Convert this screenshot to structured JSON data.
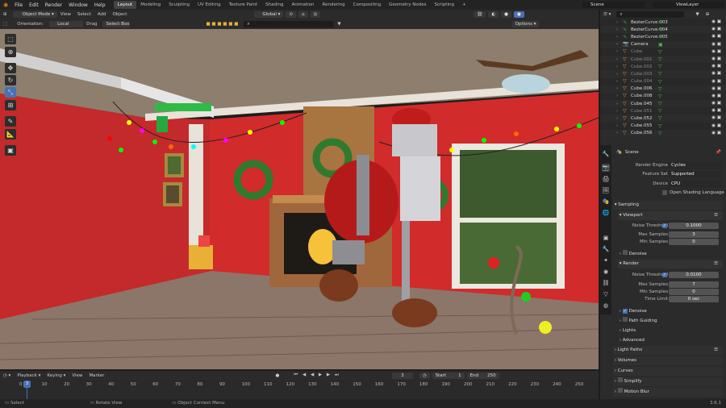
{
  "menus": [
    "File",
    "Edit",
    "Render",
    "Window",
    "Help"
  ],
  "workspaces": [
    "Layout",
    "Modeling",
    "Sculpting",
    "UV Editing",
    "Texture Paint",
    "Shading",
    "Animation",
    "Rendering",
    "Compositing",
    "Geometry Nodes",
    "Scripting"
  ],
  "add_workspace": "+",
  "scene": "Scene",
  "view_layer": "ViewLayer",
  "viewport_header": {
    "mode": "Object Mode",
    "view": "View",
    "select": "Select",
    "add": "Add",
    "object": "Object",
    "transform": "Global",
    "orientation_label": "Orientation:",
    "orientation_value": "Local",
    "drag_label": "Drag",
    "drag_value": "Select Box",
    "options": "Options"
  },
  "outliner": {
    "items": [
      {
        "name": "BezierCurve.003",
        "icon": "curve-icon",
        "dim": false
      },
      {
        "name": "BezierCurve.004",
        "icon": "curve-icon",
        "dim": false
      },
      {
        "name": "BezierCurve.005",
        "icon": "curve-icon",
        "dim": false
      },
      {
        "name": "Camera",
        "icon": "camera-icon",
        "dim": false
      },
      {
        "name": "Cube",
        "icon": "mesh-icon",
        "dim": true
      },
      {
        "name": "Cube.001",
        "icon": "mesh-icon",
        "dim": true
      },
      {
        "name": "Cube.002",
        "icon": "mesh-icon",
        "dim": true
      },
      {
        "name": "Cube.003",
        "icon": "mesh-icon",
        "dim": true
      },
      {
        "name": "Cube.004",
        "icon": "mesh-icon",
        "dim": true
      },
      {
        "name": "Cube.006",
        "icon": "mesh-icon",
        "dim": false
      },
      {
        "name": "Cube.008",
        "icon": "mesh-icon",
        "dim": false
      },
      {
        "name": "Cube.045",
        "icon": "mesh-icon",
        "dim": false
      },
      {
        "name": "Cube.051",
        "icon": "mesh-icon",
        "dim": true
      },
      {
        "name": "Cube.052",
        "icon": "mesh-icon",
        "dim": false
      },
      {
        "name": "Cube.055",
        "icon": "mesh-icon",
        "dim": false
      },
      {
        "name": "Cube.056",
        "icon": "mesh-icon",
        "dim": false
      }
    ]
  },
  "properties": {
    "scene_name": "Scene",
    "render_engine_label": "Render Engine",
    "render_engine": "Cycles",
    "feature_set_label": "Feature Set",
    "feature_set": "Supported",
    "device_label": "Device",
    "device": "CPU",
    "osl_label": "Open Shading Language",
    "sampling": "Sampling",
    "viewport": "Viewport",
    "noise_threshold_label": "Noise Threshold",
    "viewport_noise": "0.1000",
    "max_samples_label": "Max Samples",
    "viewport_max": "3",
    "min_samples_label": "Min Samples",
    "viewport_min": "0",
    "denoise_label": "Denoise",
    "render": "Render",
    "render_noise": "0.0100",
    "render_max": "7",
    "render_min": "0",
    "time_limit_label": "Time Limit",
    "time_limit": "0 sec",
    "path_guiding": "Path Guiding",
    "lights": "Lights",
    "advanced": "Advanced",
    "light_paths": "Light Paths",
    "volumes": "Volumes",
    "curves": "Curves",
    "simplify": "Simplify",
    "motion_blur": "Motion Blur"
  },
  "timeline": {
    "playback": "Playback",
    "keying": "Keying",
    "view": "View",
    "marker": "Marker",
    "current_frame": "3",
    "start_label": "Start",
    "start": "1",
    "end_label": "End",
    "end": "250",
    "ticks": [
      "0",
      "10",
      "20",
      "30",
      "40",
      "50",
      "60",
      "70",
      "80",
      "90",
      "100",
      "110",
      "120",
      "130",
      "140",
      "150",
      "160",
      "170",
      "180",
      "190",
      "200",
      "210",
      "220",
      "230",
      "240",
      "250"
    ],
    "playhead": "3"
  },
  "status": {
    "select": "Select",
    "rotate": "Rotate View",
    "context": "Object Context Menu",
    "version": "3.6.1"
  },
  "colors": {
    "accent": "#4772b3",
    "wall": "#c8202a",
    "floor": "#8a7366"
  }
}
